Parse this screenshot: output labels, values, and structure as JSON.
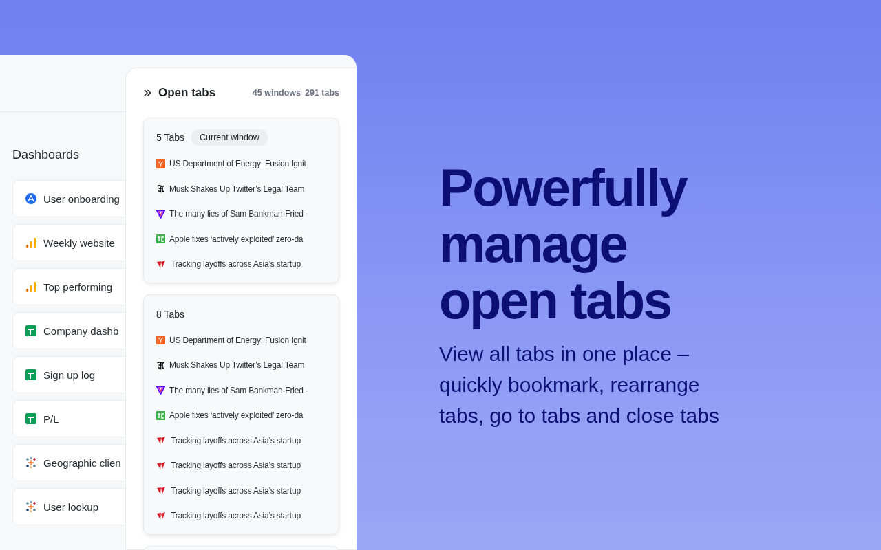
{
  "dashboards": {
    "title": "Dashboards",
    "items": [
      {
        "label": "User onboarding",
        "kind": "amplitude"
      },
      {
        "label": "Weekly website",
        "kind": "analytics"
      },
      {
        "label": "Top performing",
        "kind": "analytics"
      },
      {
        "label": "Company dashb",
        "kind": "sheets"
      },
      {
        "label": "Sign up log",
        "kind": "sheets"
      },
      {
        "label": "P/L",
        "kind": "sheets"
      },
      {
        "label": "Geographic clien",
        "kind": "tableau"
      },
      {
        "label": "User lookup",
        "kind": "tableau"
      }
    ]
  },
  "open_tabs": {
    "title": "Open tabs",
    "windows_count": "45 windows",
    "tabs_count": "291 tabs",
    "windows": [
      {
        "label": "5 Tabs",
        "badge": "Current window",
        "tabs": [
          {
            "title": "US Department of Energy: Fusion Ignit",
            "kind": "ycombinator"
          },
          {
            "title": "Musk Shakes Up Twitter’s Legal Team",
            "kind": "nyt"
          },
          {
            "title": "The many lies of Sam Bankman-Fried -",
            "kind": "verge"
          },
          {
            "title": "Apple fixes ‘actively exploited’ zero-da",
            "kind": "techcrunch"
          },
          {
            "title": "Tracking layoffs across Asia’s startup",
            "kind": "techinasia"
          }
        ]
      },
      {
        "label": "8 Tabs",
        "tabs": [
          {
            "title": "US Department of Energy: Fusion Ignit",
            "kind": "ycombinator"
          },
          {
            "title": "Musk Shakes Up Twitter’s Legal Team",
            "kind": "nyt"
          },
          {
            "title": "The many lies of Sam Bankman-Fried -",
            "kind": "verge"
          },
          {
            "title": "Apple fixes ‘actively exploited’ zero-da",
            "kind": "techcrunch"
          },
          {
            "title": "Tracking layoffs across Asia’s startup",
            "kind": "techinasia"
          },
          {
            "title": "Tracking layoffs across Asia’s startup",
            "kind": "techinasia"
          },
          {
            "title": "Tracking layoffs across Asia’s startup",
            "kind": "techinasia"
          },
          {
            "title": "Tracking layoffs across Asia’s startup",
            "kind": "techinasia"
          }
        ]
      }
    ]
  },
  "hero": {
    "heading": "Powerfully manage open tabs",
    "subheading": "View all tabs in one place – quickly bookmark, rearrange tabs, go to tabs and close tabs"
  }
}
